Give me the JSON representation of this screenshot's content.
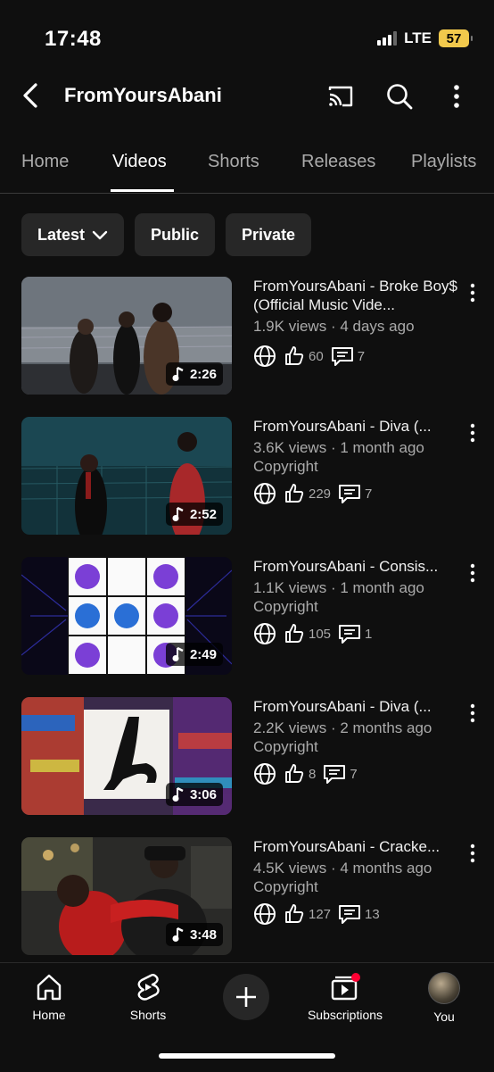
{
  "status": {
    "time": "17:48",
    "network": "LTE",
    "battery": "57"
  },
  "header": {
    "title": "FromYoursAbani"
  },
  "tabs": [
    "Home",
    "Videos",
    "Shorts",
    "Releases",
    "Playlists"
  ],
  "chips": [
    "Latest",
    "Public",
    "Private"
  ],
  "videos": [
    {
      "title": "FromYoursAbani - Broke Boy$ (Official Music Vide...",
      "views": "1.9K views",
      "age": "4 days ago",
      "extra": "",
      "duration": "2:26",
      "likes": "60",
      "comments": "7"
    },
    {
      "title": "FromYoursAbani - Diva (...",
      "views": "3.6K views",
      "age": "1 month ago",
      "extra": "Copyright",
      "duration": "2:52",
      "likes": "229",
      "comments": "7"
    },
    {
      "title": "FromYoursAbani - Consis...",
      "views": "1.1K views",
      "age": "1 month ago",
      "extra": "Copyright",
      "duration": "2:49",
      "likes": "105",
      "comments": "1"
    },
    {
      "title": "FromYoursAbani - Diva (...",
      "views": "2.2K views",
      "age": "2 months ago",
      "extra": "Copyright",
      "duration": "3:06",
      "likes": "8",
      "comments": "7"
    },
    {
      "title": "FromYoursAbani - Cracke...",
      "views": "4.5K views",
      "age": "4 months ago",
      "extra": "Copyright",
      "duration": "3:48",
      "likes": "127",
      "comments": "13"
    }
  ],
  "bottom_nav": {
    "home": "Home",
    "shorts": "Shorts",
    "subscriptions": "Subscriptions",
    "you": "You"
  },
  "separator": "·",
  "colors": {
    "background": "#0f0f0f",
    "chip": "#272727",
    "battery": "#f2c94c",
    "notification": "#ff0033"
  }
}
